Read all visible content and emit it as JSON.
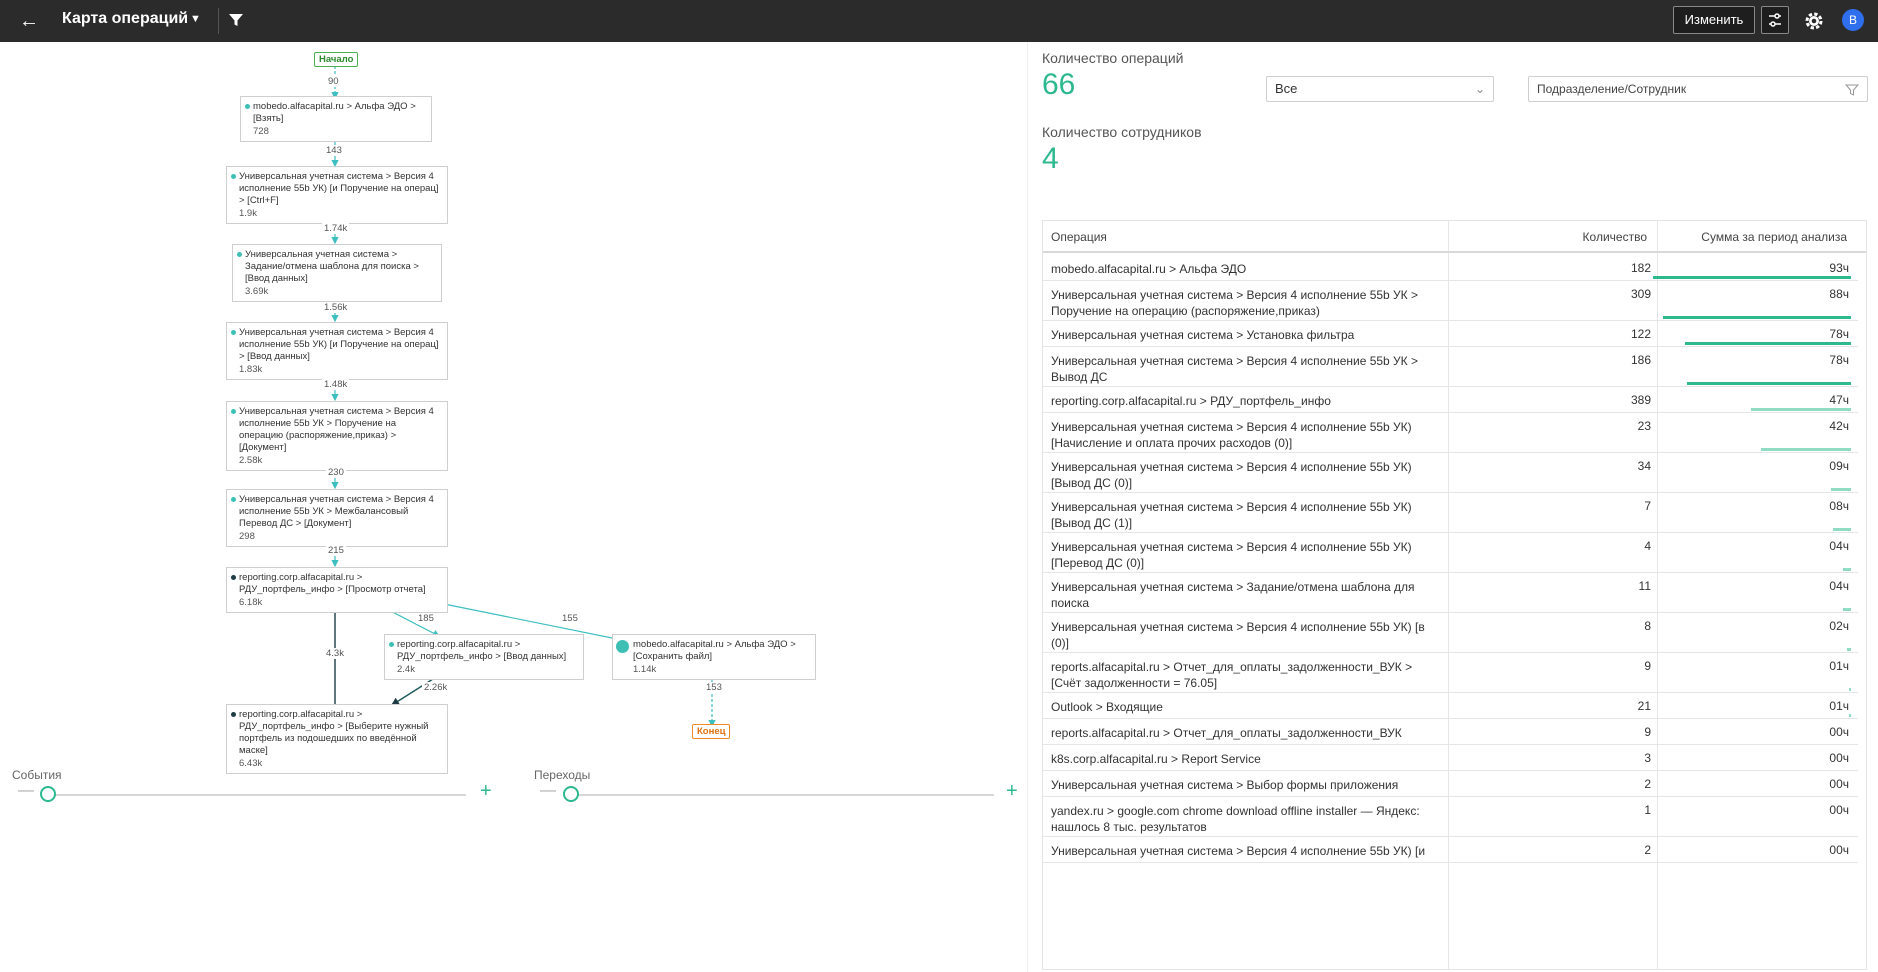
{
  "topbar": {
    "back_icon": "arrow-left-icon",
    "title": "Карта операций",
    "title_caret_icon": "caret-down-icon",
    "filter_icon": "filter-icon",
    "edit_button": "Изменить",
    "sliders_icon": "sliders-icon",
    "settings_icon": "gear-icon",
    "avatar_letter": "В"
  },
  "flow": {
    "start_label": "Начало",
    "end_label": "Конец",
    "nodes": [
      {
        "text": "mobedo.alfacapital.ru > Альфа ЭДО > [Взять]",
        "count": "728"
      },
      {
        "text": "Универсальная учетная система > Версия 4 исполнение 55b УК) [и Поручение на операц] > [Ctrl+F]",
        "count": "1.9k"
      },
      {
        "text": "Универсальная учетная система > Задание/отмена шаблона для поиска > [Ввод данных]",
        "count": "3.69k"
      },
      {
        "text": "Универсальная учетная система > Версия 4 исполнение 55b УК) [и Поручение на операц] > [Ввод данных]",
        "count": "1.83k"
      },
      {
        "text": "Универсальная учетная система > Версия 4 исполнение 55b УК > Поручение на операцию (распоряжение,приказ) > [Документ]",
        "count": "2.58k"
      },
      {
        "text": "Универсальная учетная система > Версия 4 исполнение 55b УК > Межбалансовый Перевод ДС > [Документ]",
        "count": "298"
      },
      {
        "text": "reporting.corp.alfacapital.ru > РДУ_портфель_инфо > [Просмотр отчета]",
        "count": "6.18k"
      },
      {
        "text": "reporting.corp.alfacapital.ru > РДУ_портфель_инфо > [Ввод данных]",
        "count": "2.4k"
      },
      {
        "text": "mobedo.alfacapital.ru > Альфа ЭДО > [Сохранить файл]",
        "count": "1.14k"
      },
      {
        "text": "reporting.corp.alfacapital.ru > РДУ_портфель_инфо > [Выберите нужный портфель из подошедших по введённой маске]",
        "count": "6.43k"
      }
    ],
    "edges": [
      "90",
      "143",
      "1.74k",
      "1.56k",
      "1.48k",
      "230",
      "215",
      "185",
      "155",
      "4.3k",
      "2.26k",
      "153"
    ]
  },
  "sliders": {
    "events_label": "События",
    "transitions_label": "Переходы"
  },
  "stats": {
    "ops_label": "Количество операций",
    "ops_value": "66",
    "employees_label": "Количество сотрудников",
    "employees_value": "4"
  },
  "filters": {
    "scope_value": "Все",
    "department_placeholder": "Подразделение/Сотрудник"
  },
  "table": {
    "headers": [
      "Операция",
      "Количество",
      "Сумма за период анализа"
    ],
    "rows": [
      {
        "op": "mobedo.alfacapital.ru > Альфа ЭДО",
        "count": "182",
        "sum": "93ч",
        "bar": 0.99
      },
      {
        "op": "Универсальная учетная система > Версия 4 исполнение 55b УК > Поручение на операцию (распоряжение,приказ)",
        "count": "309",
        "sum": "88ч",
        "bar": 0.94
      },
      {
        "op": "Универсальная учетная система > Установка фильтра",
        "count": "122",
        "sum": "78ч",
        "bar": 0.83
      },
      {
        "op": "Универсальная учетная система > Версия 4 исполнение 55b УК > Вывод ДС",
        "count": "186",
        "sum": "78ч",
        "bar": 0.82
      },
      {
        "op": "reporting.corp.alfacapital.ru > РДУ_портфель_инфо",
        "count": "389",
        "sum": "47ч",
        "bar": 0.5
      },
      {
        "op": "Универсальная учетная система > Версия 4 исполнение 55b УК) [Начисление и оплата прочих расходов (0)]",
        "count": "23",
        "sum": "42ч",
        "bar": 0.45
      },
      {
        "op": "Универсальная учетная система > Версия 4 исполнение 55b УК) [Вывод ДС (0)]",
        "count": "34",
        "sum": "09ч",
        "bar": 0.1
      },
      {
        "op": "Универсальная учетная система > Версия 4 исполнение 55b УК) [Вывод ДС (1)]",
        "count": "7",
        "sum": "08ч",
        "bar": 0.09
      },
      {
        "op": "Универсальная учетная система > Версия 4 исполнение 55b УК) [Перевод ДС (0)]",
        "count": "4",
        "sum": "04ч",
        "bar": 0.04
      },
      {
        "op": "Универсальная учетная система > Задание/отмена шаблона для поиска",
        "count": "11",
        "sum": "04ч",
        "bar": 0.04
      },
      {
        "op": "Универсальная учетная система > Версия 4 исполнение 55b УК) [в (0)]",
        "count": "8",
        "sum": "02ч",
        "bar": 0.02
      },
      {
        "op": "reports.alfacapital.ru > Отчет_для_оплаты_задолженности_ВУК > [Счёт задолженности = 76.05]",
        "count": "9",
        "sum": "01ч",
        "bar": 0.01
      },
      {
        "op": "Outlook > Входящие",
        "count": "21",
        "sum": "01ч",
        "bar": 0.01
      },
      {
        "op": "reports.alfacapital.ru > Отчет_для_оплаты_задолженности_ВУК",
        "count": "9",
        "sum": "00ч",
        "bar": 0.0
      },
      {
        "op": "k8s.corp.alfacapital.ru > Report Service",
        "count": "3",
        "sum": "00ч",
        "bar": 0.0
      },
      {
        "op": "Универсальная учетная система > Выбор формы приложения",
        "count": "2",
        "sum": "00ч",
        "bar": 0.0
      },
      {
        "op": "yandex.ru > google.com chrome download offline installer — Яндекс: нашлось 8 тыс. результатов",
        "count": "1",
        "sum": "00ч",
        "bar": 0.0
      },
      {
        "op": "Универсальная учетная система > Версия 4 исполнение 55b УК) [и",
        "count": "2",
        "sum": "00ч",
        "bar": 0.0
      }
    ]
  },
  "colors": {
    "accent": "#2db88f",
    "topbar": "#2b2b2b",
    "edge": "#3dbfc0",
    "edge_dark": "#1d3c44",
    "start": "#4caf50",
    "end": "#f08a24"
  }
}
